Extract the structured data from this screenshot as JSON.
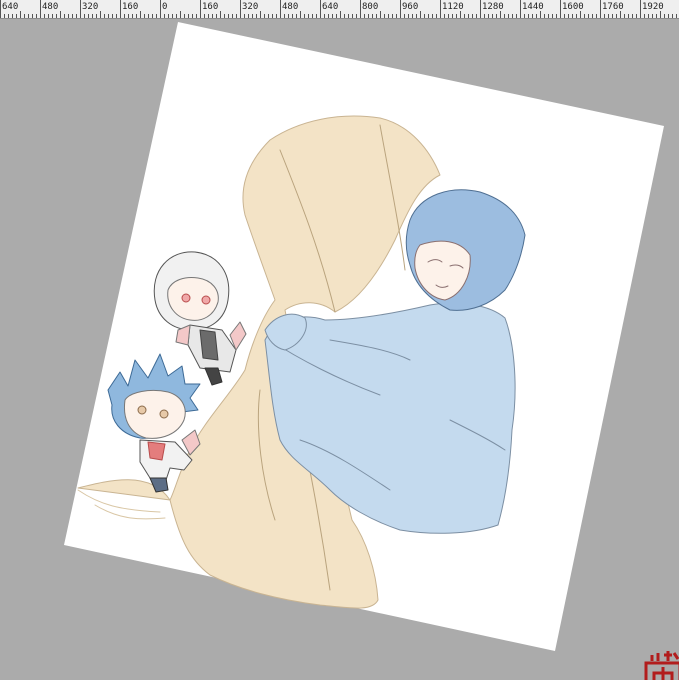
{
  "app": {
    "title": ""
  },
  "ruler": {
    "unit": "px",
    "labels": [
      "640",
      "480",
      "320",
      "160",
      "0",
      "160",
      "320",
      "480",
      "640",
      "800",
      "960",
      "1120",
      "1280",
      "1440",
      "1600",
      "1760",
      "1920"
    ]
  },
  "canvas": {
    "rotation_degrees": 11,
    "background": "#ffffff",
    "workspace_color": "#ababab"
  },
  "artwork": {
    "subject": "sketch",
    "colors": {
      "cloak": "#f3e3c6",
      "shirt": "#c4daee",
      "hair_blue": "#9cbde0",
      "skin": "#fdf2ea",
      "line": "#6a6a6a"
    }
  },
  "stamp": {
    "color": "#b21d1d"
  }
}
